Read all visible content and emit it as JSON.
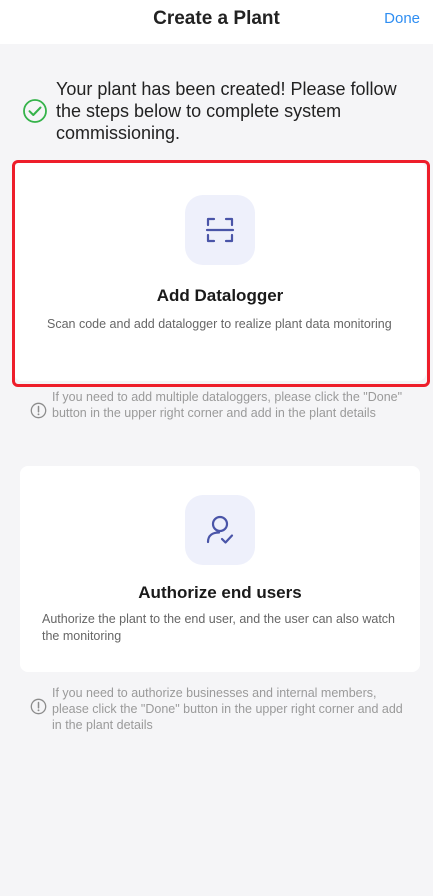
{
  "header": {
    "title": "Create a Plant",
    "done_label": "Done"
  },
  "success": {
    "icon": "check-circle-icon",
    "message": "Your plant has been created! Please follow the steps below to complete system commissioning."
  },
  "cards": [
    {
      "icon": "scan-icon",
      "title": "Add Datalogger",
      "description": "Scan code and add datalogger to realize plant data monitoring",
      "highlighted": true
    },
    {
      "icon": "user-check-icon",
      "title": "Authorize end users",
      "description": "Authorize the plant to the end user, and the user can also watch the monitoring"
    }
  ],
  "notes": [
    {
      "icon": "info-icon",
      "text": "If you need to add multiple dataloggers, please click the \"Done\" button in the upper right corner and add in the plant details"
    },
    {
      "icon": "info-icon",
      "text": "If you need to authorize businesses and internal members, please click the \"Done\" button in the upper right corner and add in the plant details"
    }
  ],
  "colors": {
    "accent": "#2f8ef2",
    "success": "#35b34a",
    "highlight": "#ee1e2a",
    "icon_bg": "#eef0fb",
    "icon_stroke": "#4a55a8"
  }
}
